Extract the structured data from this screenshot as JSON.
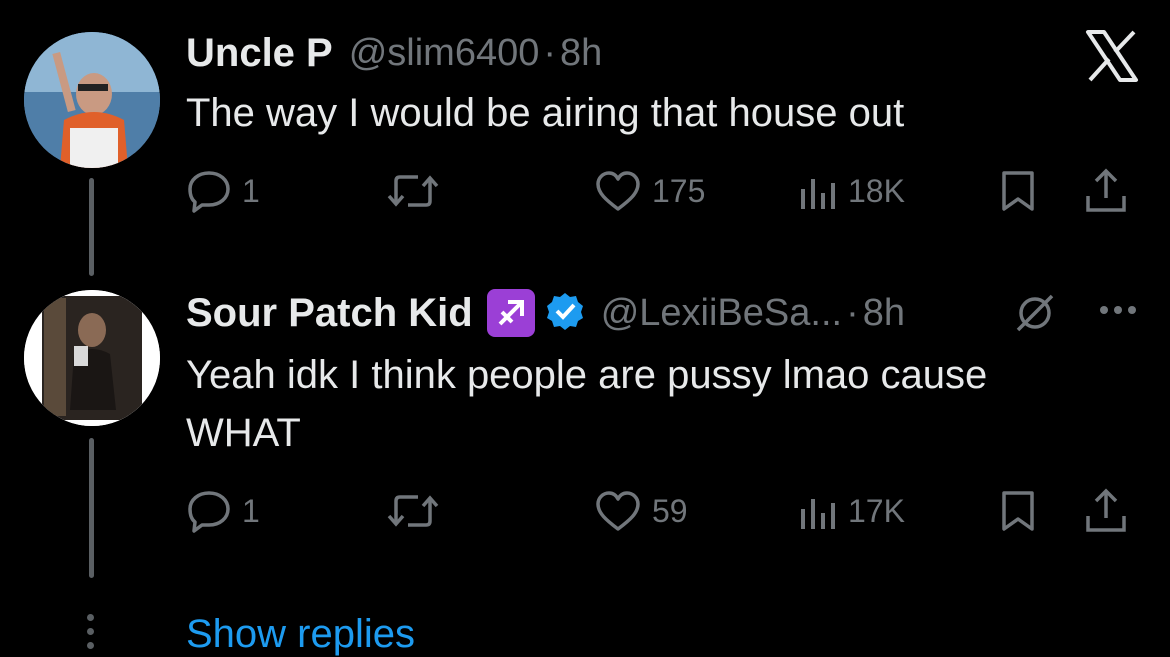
{
  "tweets": [
    {
      "name": "Uncle P",
      "handle": "@slim6400",
      "separator": "·",
      "time": "8h",
      "text": "The way I would be airing that house out",
      "replies": "1",
      "likes": "175",
      "views": "18K"
    },
    {
      "name": "Sour Patch Kid",
      "handle": "@LexiiBeSa...",
      "separator": "·",
      "time": "8h",
      "text": "Yeah idk I think people are pussy lmao cause WHAT",
      "replies": "1",
      "likes": "59",
      "views": "17K"
    }
  ],
  "show_replies": "Show replies",
  "icons": [
    "x-logo-icon",
    "reply-icon",
    "retweet-icon",
    "like-icon",
    "views-icon",
    "bookmark-icon",
    "share-icon",
    "sagittarius-icon",
    "verified-icon",
    "mute-icon",
    "more-icon"
  ],
  "colors": {
    "background": "#000000",
    "text": "#e7e9ea",
    "secondary": "#71767b",
    "link": "#1d9bf0",
    "verified": "#1d9bf0"
  }
}
